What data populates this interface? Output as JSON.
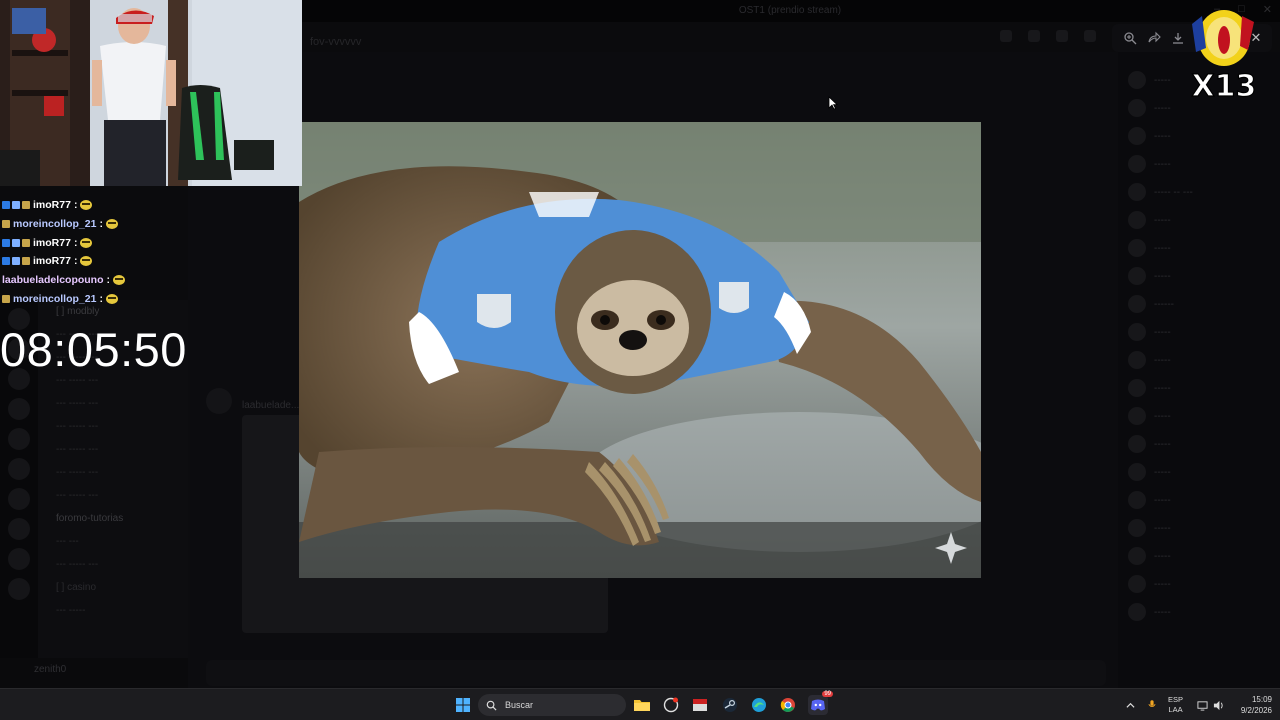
{
  "discord": {
    "window_title": "OST1 (prendio stream)",
    "channel_name": "fov-vvvvvv",
    "channels": [
      "[ ] modbly",
      "--- ----- ---",
      "--- ----- ---",
      "--- ----- ---",
      "--- ----- ---",
      "--- ----- ---",
      "--- ----- ---",
      "--- ----- ---",
      "--- ----- ---",
      "foromo-tutorias",
      "--- ---",
      "--- ----- ---",
      "[ ] casino",
      "--- -----"
    ],
    "user_label": "zenith0",
    "message_author": "laabuelade...",
    "members": [
      "-----",
      "-----",
      "-----",
      "-----",
      "----- -- ---",
      "-----",
      "-----",
      "-----",
      "------",
      "-----",
      "-----",
      "-----",
      "-----",
      "-----",
      "-----",
      "-----",
      "-----",
      "-----",
      "-----",
      "-----"
    ]
  },
  "viewer": {
    "zoom_icon": "zoom-in-icon",
    "open_icon": "forward-icon",
    "download_icon": "download-icon",
    "more_icon": "more-icon",
    "close_icon": "close-icon"
  },
  "stream_overlay": {
    "chat": [
      {
        "user": "imoR77",
        "sep": " :",
        "user_color": "#ffffff",
        "badges": [
          "#2c7be5",
          "#7fb0ff",
          "#c7a54a"
        ]
      },
      {
        "user": "moreincollop_21",
        "sep": " :",
        "user_color": "#b9c9ff",
        "badges": [
          "#c7a54a"
        ]
      },
      {
        "user": "imoR77",
        "sep": " :",
        "user_color": "#ffffff",
        "badges": [
          "#2c7be5",
          "#7fb0ff",
          "#c7a54a"
        ]
      },
      {
        "user": "imoR77",
        "sep": " :",
        "user_color": "#ffffff",
        "badges": [
          "#2c7be5",
          "#7fb0ff",
          "#c7a54a"
        ]
      },
      {
        "user": "laabueladelcopouno",
        "sep": " :",
        "user_color": "#e6c8ff",
        "badges": []
      },
      {
        "user": "moreincollop_21",
        "sep": " :",
        "user_color": "#b9c9ff",
        "badges": [
          "#c7a54a"
        ]
      }
    ],
    "timer": "08:05:50",
    "logo_text": "X13"
  },
  "taskbar": {
    "search_placeholder": "Buscar",
    "lang_top": "ESP",
    "lang_bottom": "LAA",
    "time": "15:09",
    "date": "9/2/2026",
    "discord_badge": "99"
  },
  "colors": {
    "sloth_jersey": "#4f8fd6",
    "taskbar": "#1c1c1f"
  }
}
